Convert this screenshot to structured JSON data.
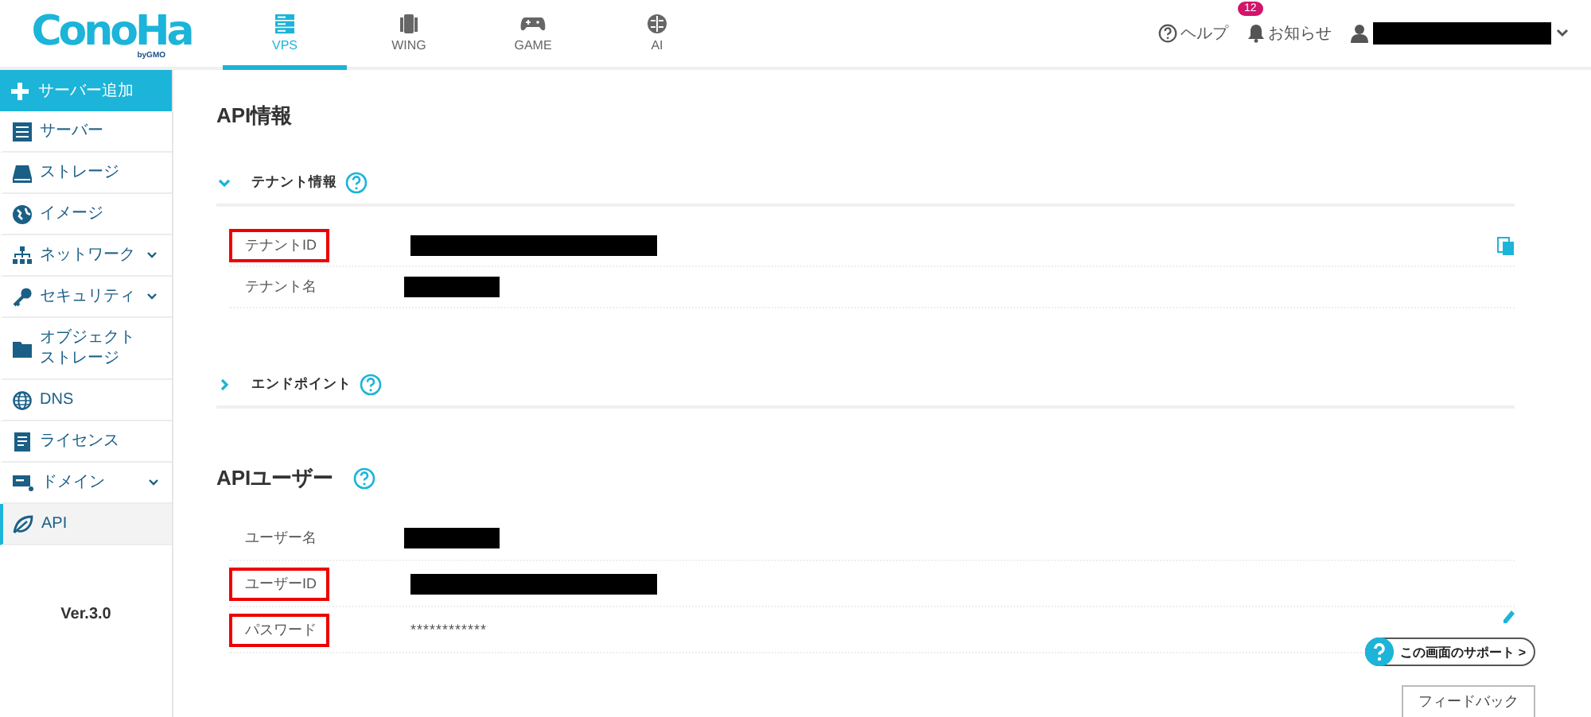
{
  "header": {
    "logo": {
      "name": "ConoHa",
      "sub": "byGMO"
    },
    "tabs": [
      {
        "label": "VPS",
        "selected": true
      },
      {
        "label": "WING",
        "selected": false
      },
      {
        "label": "GAME",
        "selected": false
      },
      {
        "label": "AI",
        "selected": false
      }
    ],
    "help": "ヘルプ",
    "notifications": {
      "label": "お知らせ",
      "badge": "12"
    },
    "user": {
      "redacted": true
    }
  },
  "sidebar": {
    "add_button": "サーバー追加",
    "items": [
      {
        "label": "サーバー",
        "expandable": false,
        "selected": false
      },
      {
        "label": "ストレージ",
        "expandable": false,
        "selected": false
      },
      {
        "label": "イメージ",
        "expandable": false,
        "selected": false
      },
      {
        "label": "ネットワーク",
        "expandable": true,
        "selected": false
      },
      {
        "label": "セキュリティ",
        "expandable": true,
        "selected": false
      },
      {
        "label": "オブジェクトストレージ",
        "expandable": false,
        "selected": false
      },
      {
        "label": "DNS",
        "expandable": false,
        "selected": false
      },
      {
        "label": "ライセンス",
        "expandable": false,
        "selected": false
      },
      {
        "label": "ドメイン",
        "expandable": true,
        "selected": false
      },
      {
        "label": "API",
        "expandable": false,
        "selected": true
      }
    ],
    "version": "Ver.3.0"
  },
  "main": {
    "title": "API情報",
    "sections": [
      {
        "title": "テナント情報",
        "expanded": true,
        "rows": [
          {
            "label": "テナントID",
            "highlighted": true,
            "kind": "redactedlong",
            "copy": true
          },
          {
            "label": "テナント名",
            "highlighted": false,
            "kind": "redactedshort",
            "copy": false
          }
        ]
      },
      {
        "title": "エンドポイント",
        "expanded": false
      }
    ],
    "user_section": {
      "title": "APIユーザー",
      "rows": [
        {
          "label": "ユーザー名",
          "highlighted": false,
          "kind": "redactedshort",
          "editable": false
        },
        {
          "label": "ユーザーID",
          "highlighted": true,
          "kind": "redactedlong",
          "editable": false
        },
        {
          "label": "パスワード",
          "highlighted": true,
          "kind": "text",
          "value": "************",
          "editable": true
        }
      ]
    }
  },
  "support_button": "この画面のサポート >",
  "feedback_button": "フィードバック"
}
